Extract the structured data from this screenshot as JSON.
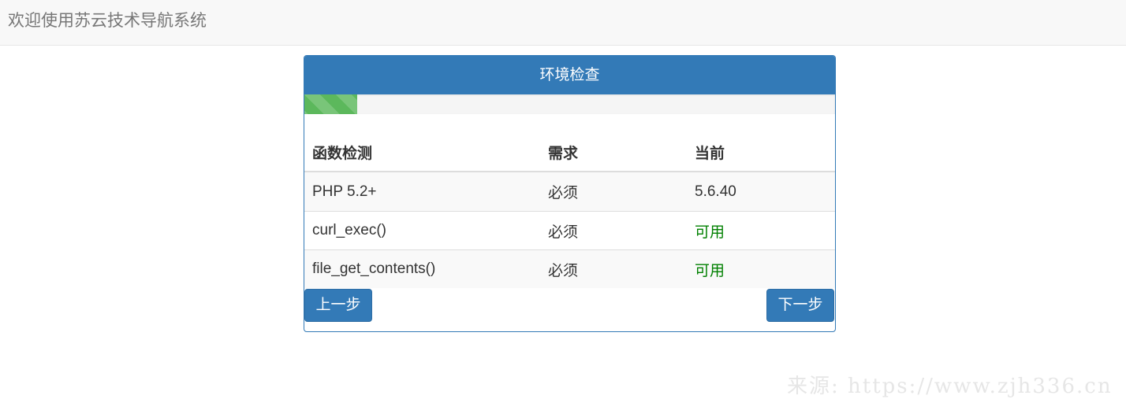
{
  "header": {
    "title": "欢迎使用苏云技术导航系统"
  },
  "panel": {
    "title": "环境检查",
    "progress": 0.1
  },
  "table": {
    "columns": [
      "函数检测",
      "需求",
      "当前"
    ],
    "rows": [
      {
        "name": "PHP 5.2+",
        "requirement": "必须",
        "current": "5.6.40"
      },
      {
        "name": "curl_exec()",
        "requirement": "必须",
        "current": "可用"
      },
      {
        "name": "file_get_contents()",
        "requirement": "必须",
        "current": "可用"
      }
    ]
  },
  "buttons": {
    "prev": "上一步",
    "next": "下一步"
  },
  "watermark": "来源: https://www.zjh336.cn",
  "colors": {
    "primary": "#337ab7",
    "success": "#5cb85c",
    "available_text": "#008000"
  }
}
